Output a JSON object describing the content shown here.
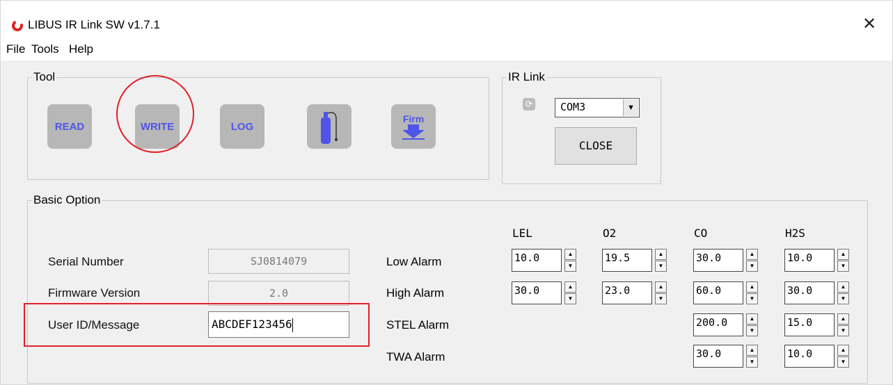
{
  "window": {
    "title": "LIBUS IR Link SW v1.7.1",
    "close_glyph": "✕"
  },
  "menu": [
    "File",
    "Tools",
    "Help"
  ],
  "tool": {
    "label": "Tool",
    "buttons": {
      "read": "READ",
      "write": "WRITE",
      "log": "LOG",
      "firm": "Firm"
    }
  },
  "ir_link": {
    "label": "IR Link",
    "port": "COM3",
    "close_label": "CLOSE"
  },
  "basic": {
    "label": "Basic Option",
    "serial_label": "Serial Number",
    "serial_value": "SJ0814079",
    "firmware_label": "Firmware Version",
    "firmware_value": "2.0",
    "user_label": "User ID/Message",
    "user_value": "ABCDEF123456"
  },
  "alarms": {
    "columns": [
      "LEL",
      "O2",
      "CO",
      "H2S"
    ],
    "rows": [
      "Low Alarm",
      "High Alarm",
      "STEL Alarm",
      "TWA Alarm"
    ],
    "values": {
      "low": [
        "10.0",
        "19.5",
        "30.0",
        "10.0"
      ],
      "high": [
        "30.0",
        "23.0",
        "60.0",
        "30.0"
      ],
      "stel": [
        "200.0",
        "15.0"
      ],
      "twa": [
        "30.0",
        "10.0"
      ]
    }
  },
  "colors": {
    "accent_text": "#4f55e8",
    "highlight": "#e0202a",
    "button_bg": "#b7b7b7"
  }
}
